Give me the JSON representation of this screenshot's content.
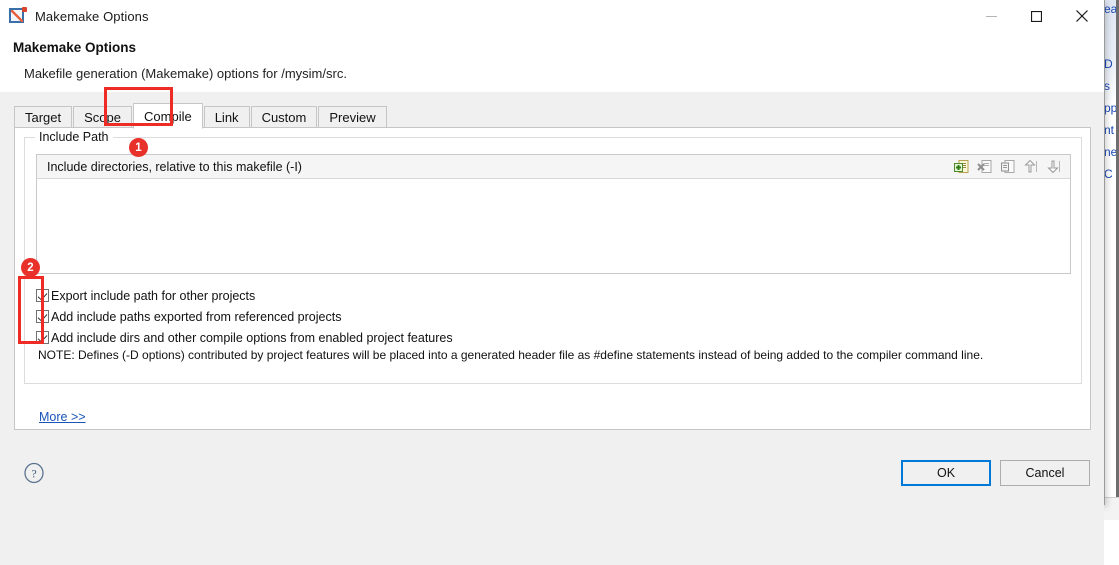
{
  "window": {
    "title": "Makemake Options",
    "icon": "edit-properties-icon",
    "controls": {
      "minimize": "minimize-icon",
      "maximize": "maximize-icon",
      "close": "close-icon"
    }
  },
  "header": {
    "heading": "Makemake Options",
    "subheading": "Makefile generation (Makemake) options for /mysim/src."
  },
  "tabs": [
    {
      "label": "Target",
      "selected": false
    },
    {
      "label": "Scope",
      "selected": false
    },
    {
      "label": "Compile",
      "selected": true
    },
    {
      "label": "Link",
      "selected": false
    },
    {
      "label": "Custom",
      "selected": false
    },
    {
      "label": "Preview",
      "selected": false
    }
  ],
  "compile_tab": {
    "group_title": "Include Path",
    "list": {
      "header_label": "Include directories, relative to this makefile (-I)",
      "items": [],
      "toolbar": [
        {
          "name": "add-icon",
          "tip": "Add"
        },
        {
          "name": "remove-icon",
          "tip": "Remove"
        },
        {
          "name": "edit-icon",
          "tip": "Edit"
        },
        {
          "name": "move-up-icon",
          "tip": "Move Up"
        },
        {
          "name": "move-down-icon",
          "tip": "Move Down"
        }
      ]
    },
    "checkboxes": [
      {
        "label": "Export include path for other projects",
        "checked": true
      },
      {
        "label": "Add include paths exported from referenced projects",
        "checked": true
      },
      {
        "label": "Add include dirs and other compile options from enabled project features",
        "checked": true
      }
    ],
    "note": "NOTE: Defines (-D options) contributed by project features will be placed into a generated header file as #define statements instead of being added to the compiler command line.",
    "more_link": "More >>"
  },
  "footer": {
    "help": "help-icon",
    "ok_label": "OK",
    "cancel_label": "Cancel"
  },
  "annotations": [
    {
      "badge": "1",
      "target": "compile-tab"
    },
    {
      "badge": "2",
      "target": "checkbox-group"
    }
  ],
  "background": {
    "fragments": [
      "ea",
      "D",
      "s",
      "pp",
      "nt",
      "ne",
      "C"
    ]
  },
  "colors": {
    "annotation_red": "#ee2b24",
    "default_button_blue": "#0078d7",
    "link_blue": "#1a54b8",
    "dialog_bg": "#f0f0f0"
  }
}
